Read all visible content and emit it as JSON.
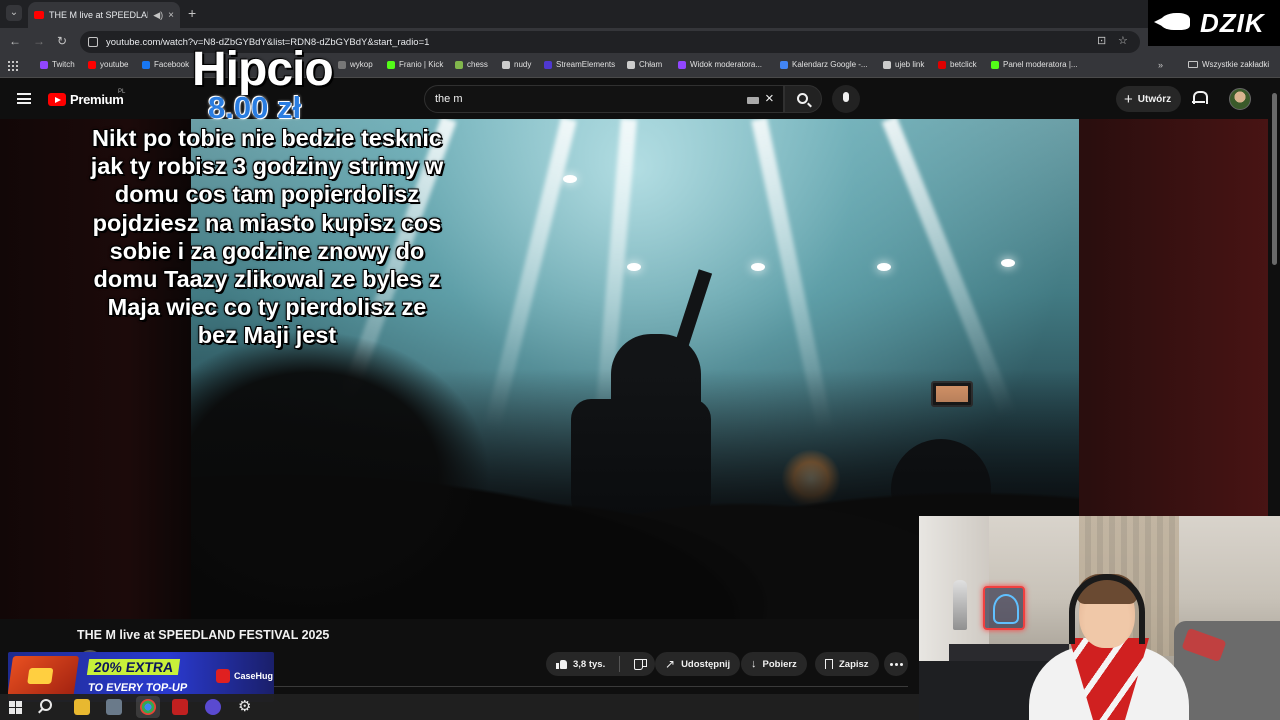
{
  "browser": {
    "tab": {
      "title": "THE M live at SPEEDLAND F",
      "speaker_icon": "speaker-icon",
      "close": "×"
    },
    "new_tab": "+",
    "nav": {
      "back": "←",
      "forward": "→",
      "reload": "↻"
    },
    "url": "youtube.com/watch?v=N8-dZbGYBdY&list=RDN8-dZbGYBdY&start_radio=1",
    "bookmarks": [
      {
        "label": "Twitch",
        "color": "#9146ff"
      },
      {
        "label": "youtube",
        "color": "#ff0000"
      },
      {
        "label": "Facebook",
        "color": "#1877f2"
      },
      {
        "label": "wykop",
        "color": "#777777"
      },
      {
        "label": "Franio | Kick",
        "color": "#53fc18"
      },
      {
        "label": "chess",
        "color": "#81b64c"
      },
      {
        "label": "nudy",
        "color": "#cccccc"
      },
      {
        "label": "StreamElements",
        "color": "#4e38d1"
      },
      {
        "label": "Chłam",
        "color": "#cccccc"
      },
      {
        "label": "Widok moderatora...",
        "color": "#9146ff"
      },
      {
        "label": "Kalendarz Google -...",
        "color": "#4285f4"
      },
      {
        "label": "ujeb link",
        "color": "#cccccc"
      },
      {
        "label": "betclick",
        "color": "#e00000"
      },
      {
        "label": "Panel moderatora |...",
        "color": "#53fc18"
      }
    ],
    "bookmarks_more": "»",
    "all_bookmarks": "Wszystkie zakładki"
  },
  "youtube": {
    "brand": "Premium",
    "country": "PL",
    "search_value": "the m",
    "clear": "×",
    "create_label": "Utwórz",
    "create_plus": "+"
  },
  "donation": {
    "name": "Hipcio",
    "amount": "8.00 zł",
    "message": "Nikt po tobie nie bedzie tesknic jak ty robisz 3 godziny strimy w domu cos tam popierdolisz pojdziesz na miasto kupisz cos sobie i za godzine znowy do domu Taazy zlikowal ze byles z Maja wiec co ty pierdolisz ze bez Maji jest"
  },
  "overlay_logo": "DZIK",
  "video": {
    "title": "THE M live at SPEEDLAND FESTIVAL 2025",
    "likes": "3,8 tys.",
    "share": "Udostępnij",
    "download": "Pobierz",
    "save": "Zapisz"
  },
  "ad": {
    "line1": "20% EXTRA",
    "line2": "TO EVERY TOP-UP",
    "brand": "CaseHug"
  },
  "colors": {
    "youtube_red": "#ff0000",
    "donation_amount": "#2a7de1",
    "ad_highlight": "#c8f03a"
  }
}
